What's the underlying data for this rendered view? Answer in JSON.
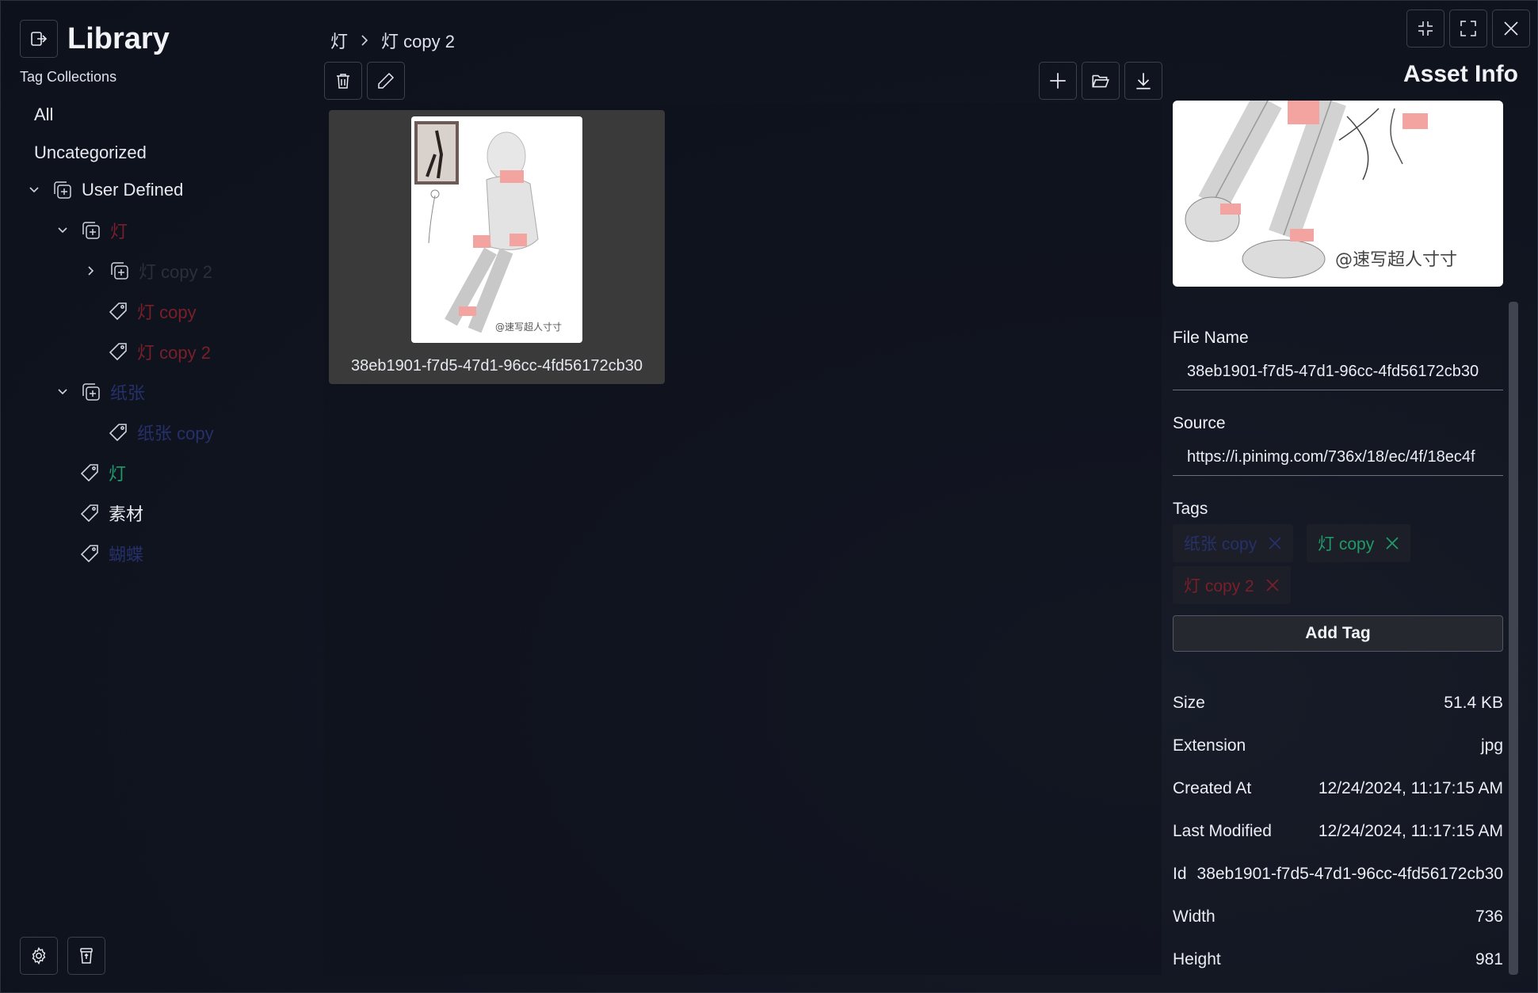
{
  "sidebar": {
    "title": "Library",
    "subtitle": "Tag Collections",
    "items": [
      {
        "label": "All",
        "color": "#e8eaf0"
      },
      {
        "label": "Uncategorized",
        "color": "#e8eaf0"
      },
      {
        "label": "User Defined",
        "color": "#e8eaf0"
      },
      {
        "label": "灯",
        "color": "#7a1f2a"
      },
      {
        "label": "灯 copy 2",
        "color": "#2a2f3c"
      },
      {
        "label": "灯 copy",
        "color": "#7a1f2a"
      },
      {
        "label": "灯 copy 2",
        "color": "#7a1f2a"
      },
      {
        "label": "纸张",
        "color": "#26306a"
      },
      {
        "label": "纸张 copy",
        "color": "#26306a"
      },
      {
        "label": "灯",
        "color": "#1f9a6a"
      },
      {
        "label": "素材",
        "color": "#e8eaf0"
      },
      {
        "label": "蝴蝶",
        "color": "#26306a"
      }
    ]
  },
  "breadcrumb": {
    "parent": "灯",
    "current": "灯 copy 2"
  },
  "card": {
    "caption": "38eb1901-f7d5-47d1-96cc-4fd56172cb30",
    "watermark": "@速写超人寸寸"
  },
  "asset_info": {
    "title": "Asset Info",
    "preview_watermark": "@速写超人寸寸",
    "file_name_label": "File Name",
    "file_name_value": "38eb1901-f7d5-47d1-96cc-4fd56172cb30",
    "source_label": "Source",
    "source_value": "https://i.pinimg.com/736x/18/ec/4f/18ec4f",
    "tags_label": "Tags",
    "tags": [
      {
        "label": "纸张 copy",
        "color": "#26306a"
      },
      {
        "label": "灯 copy",
        "color": "#1f9a6a"
      },
      {
        "label": "灯 copy 2",
        "color": "#7a1f2a"
      }
    ],
    "add_tag_label": "Add Tag",
    "props": [
      {
        "label": "Size",
        "value": "51.4 KB"
      },
      {
        "label": "Extension",
        "value": "jpg"
      },
      {
        "label": "Created At",
        "value": "12/24/2024, 11:17:15 AM"
      },
      {
        "label": "Last Modified",
        "value": "12/24/2024, 11:17:15 AM"
      },
      {
        "label": "Id",
        "value": "38eb1901-f7d5-47d1-96cc-4fd56172cb30"
      },
      {
        "label": "Width",
        "value": "736"
      },
      {
        "label": "Height",
        "value": "981"
      }
    ]
  },
  "icons": {
    "exit": "exit-icon",
    "settings": "gear-icon",
    "recycle": "recycle-bin-icon",
    "delete": "trash-icon",
    "rename": "pencil-icon",
    "add": "plus-icon",
    "open_folder": "folder-open-icon",
    "download": "download-icon",
    "minimize": "minimize-icon",
    "fullscreen": "fullscreen-icon",
    "close": "close-icon"
  }
}
